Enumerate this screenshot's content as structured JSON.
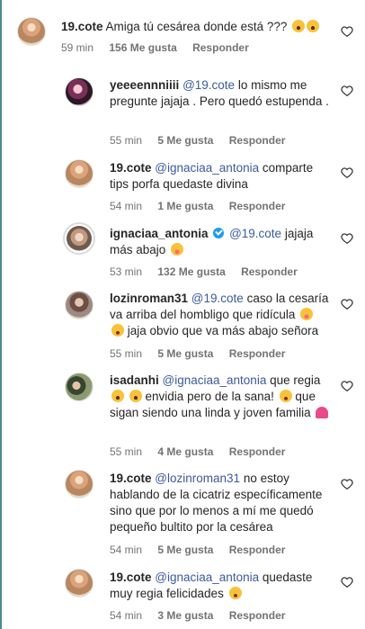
{
  "comments": [
    {
      "username": "19.cote",
      "text": "Amiga tú cesárea donde está ???",
      "emoji": [
        "scream",
        "scream"
      ],
      "time": "59 min",
      "likes": "156 Me gusta",
      "reply": "Responder"
    },
    {
      "username": "yeeeennniiii",
      "mention": "@19.cote",
      "text": "lo mismo me pregunte jajaja . Pero quedó estupenda .",
      "time": "55 min",
      "likes": "5 Me gusta",
      "reply": "Responder"
    },
    {
      "username": "19.cote",
      "mention": "@ignaciaa_antonia",
      "text": "comparte tips porfa quedaste divina",
      "time": "54 min",
      "likes": "1 Me gusta",
      "reply": "Responder"
    },
    {
      "username": "ignaciaa_antonia",
      "mention": "@19.cote",
      "text": "jajaja más abajo",
      "time": "53 min",
      "likes": "132 Me gusta",
      "reply": "Responder"
    },
    {
      "username": "lozinroman31",
      "mention": "@19.cote",
      "text1": "caso la cesaría va arriba del hombligo que ridícula",
      "text2": "jaja obvio que va más abajo señora",
      "time": "55 min",
      "likes": "5 Me gusta",
      "reply": "Responder"
    },
    {
      "username": "isadanhi",
      "mention": "@ignaciaa_antonia",
      "text1": "que regia",
      "text2": "envidia pero de la sana!",
      "text3": "que sigan siendo una linda y joven familia",
      "time": "55 min",
      "likes": "4 Me gusta",
      "reply": "Responder"
    },
    {
      "username": "19.cote",
      "mention": "@lozinroman31",
      "text": "no estoy hablando de la cicatriz específicamente sino que por lo menos a mí me quedó pequeño bultito por la cesárea",
      "time": "54 min",
      "likes": "5 Me gusta",
      "reply": "Responder"
    },
    {
      "username": "19.cote",
      "mention": "@ignaciaa_antonia",
      "text": "quedaste muy regia felicidades",
      "time": "54 min",
      "likes": "3 Me gusta",
      "reply": "Responder"
    }
  ],
  "icons": {
    "like": "heart-outline-icon",
    "verified": "verified-badge-icon"
  },
  "colors": {
    "mention": "#3c5a9a",
    "meta": "#737373",
    "side_bar": "#4a8a93"
  }
}
